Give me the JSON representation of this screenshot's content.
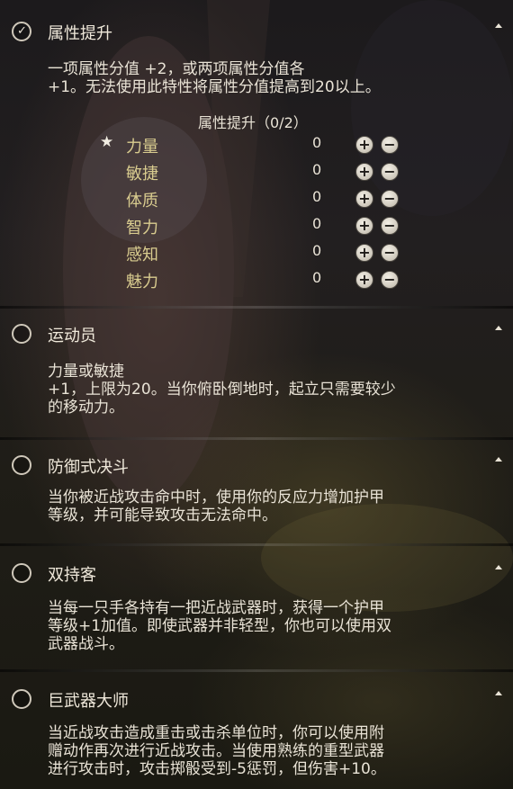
{
  "sections": [
    {
      "title": "属性提升",
      "checked": true,
      "desc": [
        "一项属性分值 +2，或两项属性分值各",
        "+1。无法使用此特性将属性分值提高到20以上。"
      ],
      "sub_title": "属性提升（0/2）",
      "attributes": [
        {
          "name": "力量",
          "value": "0",
          "starred": true
        },
        {
          "name": "敏捷",
          "value": "0",
          "starred": false
        },
        {
          "name": "体质",
          "value": "0",
          "starred": false
        },
        {
          "name": "智力",
          "value": "0",
          "starred": false
        },
        {
          "name": "感知",
          "value": "0",
          "starred": false
        },
        {
          "name": "魅力",
          "value": "0",
          "starred": false
        }
      ]
    },
    {
      "title": "运动员",
      "checked": false,
      "desc": [
        "力量或敏捷",
        "+1，上限为20。当你俯卧倒地时，起立只需要较少",
        "的移动力。"
      ]
    },
    {
      "title": "防御式决斗",
      "checked": false,
      "desc": [
        "当你被近战攻击命中时，使用你的反应力增加护甲",
        "等级，并可能导致攻击无法命中。"
      ]
    },
    {
      "title": "双持客",
      "checked": false,
      "desc": [
        "当每一只手各持有一把近战武器时，获得一个护甲",
        "等级+1加值。即使武器并非轻型，你也可以使用双",
        "武器战斗。"
      ]
    },
    {
      "title": "巨武器大师",
      "checked": false,
      "desc": [
        "当近战攻击造成重击或击杀单位时，你可以使用附",
        "赠动作再次进行近战攻击。当使用熟练的重型武器",
        "进行攻击时，攻击掷骰受到-5惩罚，但伤害+10。"
      ]
    }
  ],
  "icons": {
    "check": "checkmark-icon",
    "star": "star-icon",
    "plus": "plus-icon",
    "minus": "minus-icon",
    "collapse": "caret-up-icon"
  }
}
